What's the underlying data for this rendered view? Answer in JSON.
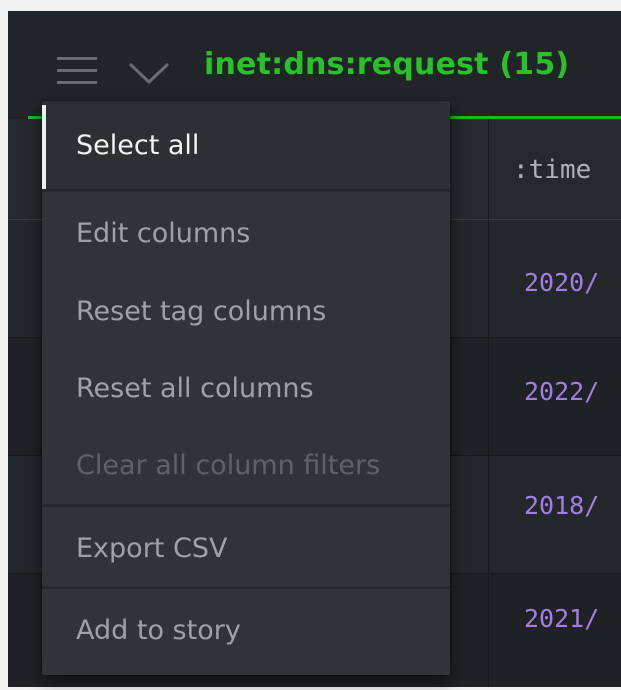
{
  "header": {
    "title": "inet:dns:request (15)"
  },
  "table": {
    "column_header": ":time",
    "rows": [
      {
        "time": "2020/"
      },
      {
        "time": "2022/"
      },
      {
        "time": "2018/"
      },
      {
        "time": "2021/"
      }
    ]
  },
  "menu": {
    "items": [
      {
        "label": "Select all",
        "state": "selected"
      },
      {
        "label": "Edit columns",
        "state": "enabled"
      },
      {
        "label": "Reset tag columns",
        "state": "enabled"
      },
      {
        "label": "Reset all columns",
        "state": "enabled"
      },
      {
        "label": "Clear all column filters",
        "state": "disabled"
      },
      {
        "label": "Export CSV",
        "state": "enabled"
      },
      {
        "label": "Add to story",
        "state": "enabled"
      }
    ]
  },
  "icons": {
    "menu_toggle": "hamburger-icon",
    "expand": "chevron-down-icon"
  },
  "colors": {
    "accent_green": "#29c12a",
    "time_value": "#a07ee5",
    "background": "#1f2124",
    "menu_background": "#303437"
  }
}
